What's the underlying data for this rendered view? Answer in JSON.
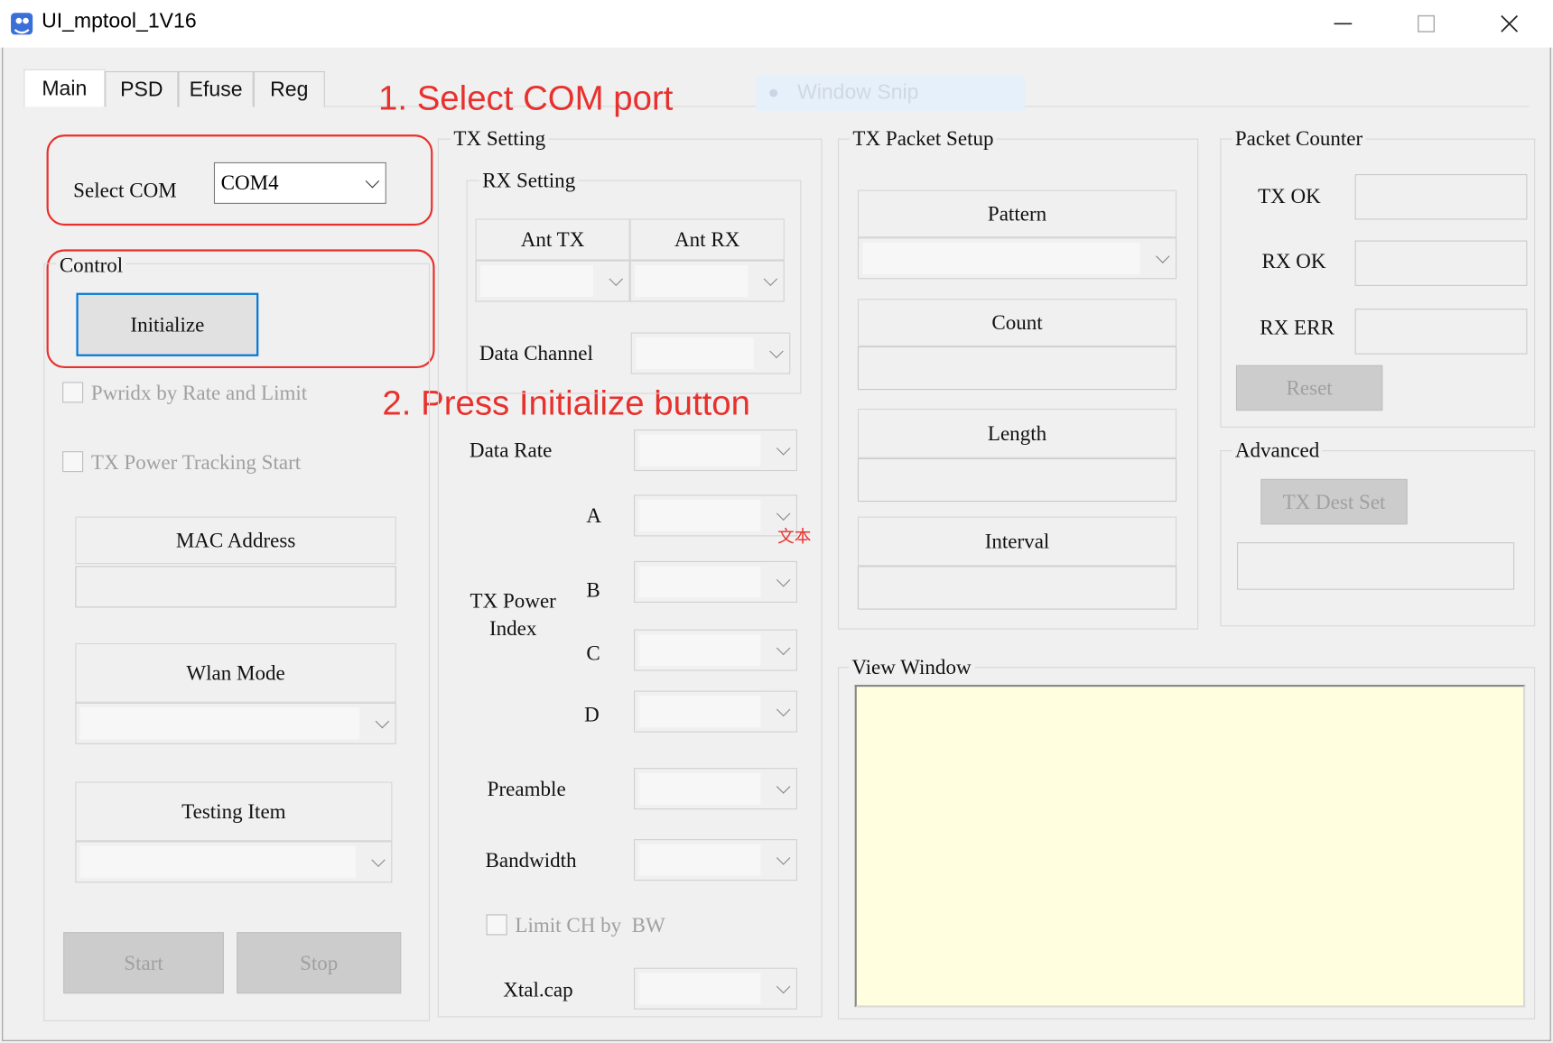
{
  "window": {
    "title": "UI_mptool_1V16"
  },
  "tabs": [
    {
      "label": "Main",
      "active": true
    },
    {
      "label": "PSD"
    },
    {
      "label": "Efuse"
    },
    {
      "label": "Reg"
    }
  ],
  "overlay": {
    "window_snip": "Window Snip"
  },
  "annotations": {
    "step1": "1. Select COM port",
    "step2": "2. Press Initialize button",
    "small_text": "文本",
    "color": "#e8312d"
  },
  "com": {
    "label": "Select COM",
    "value": "COM4"
  },
  "control": {
    "legend": "Control",
    "initialize_label": "Initialize",
    "pwridx_label": "Pwridx by Rate and Limit",
    "tx_power_tracking_label": "TX Power Tracking Start",
    "mac_address_label": "MAC Address",
    "wlan_mode_label": "Wlan Mode",
    "testing_item_label": "Testing Item",
    "start_label": "Start",
    "stop_label": "Stop"
  },
  "tx_setting": {
    "legend": "TX Setting",
    "rx_setting": {
      "legend": "RX Setting",
      "ant_tx": "Ant TX",
      "ant_rx": "Ant RX",
      "data_channel": "Data Channel"
    },
    "data_rate": "Data Rate",
    "tx_power_index": "TX Power Index",
    "a": "A",
    "b": "B",
    "c": "C",
    "d": "D",
    "preamble": "Preamble",
    "bandwidth": "Bandwidth",
    "limit_ch_by_bw": "Limit CH by  BW",
    "xtal_cap": "Xtal.cap"
  },
  "tx_packet_setup": {
    "legend": "TX Packet Setup",
    "pattern": "Pattern",
    "count": "Count",
    "length": "Length",
    "interval": "Interval"
  },
  "packet_counter": {
    "legend": "Packet Counter",
    "tx_ok": "TX OK",
    "rx_ok": "RX OK",
    "rx_err": "RX ERR",
    "reset_label": "Reset"
  },
  "advanced": {
    "legend": "Advanced",
    "tx_dest_set_label": "TX Dest Set"
  },
  "view_window": {
    "legend": "View Window",
    "background": "#ffffe0"
  }
}
